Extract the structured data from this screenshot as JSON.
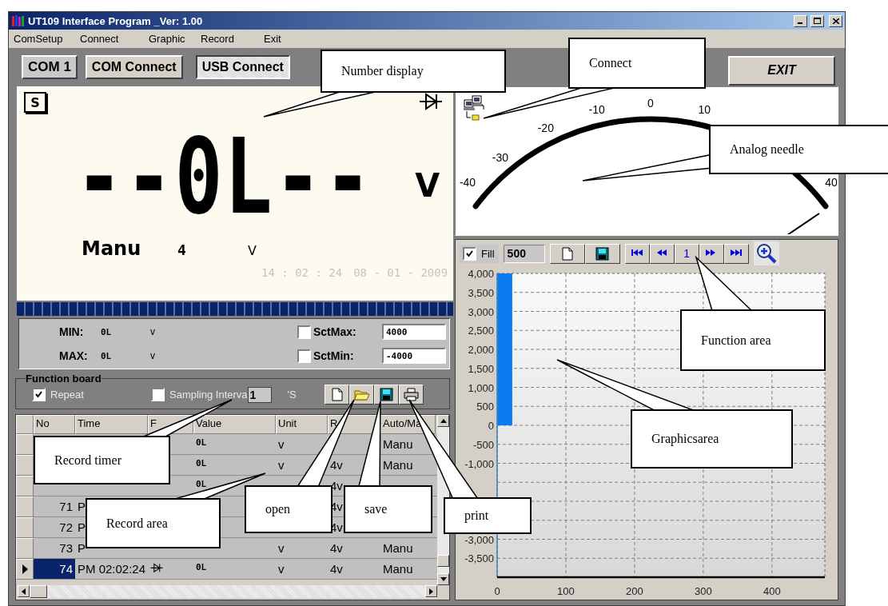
{
  "window": {
    "title": "UT109 Interface Program _Ver: 1.00"
  },
  "menu": [
    "ComSetup",
    "Connect",
    "Graphic",
    "Record",
    "Exit"
  ],
  "toolbar": {
    "port": "COM 1",
    "buttons": [
      {
        "label": "COM Connect",
        "selected": false
      },
      {
        "label": "USB Connect",
        "selected": true
      }
    ],
    "exit": "EXIT"
  },
  "display": {
    "mode": "S",
    "reading": "--0L--",
    "unit": "V",
    "range_mode": "Manu",
    "range": "4",
    "range_unit": "V",
    "time": "14 : 02 : 24",
    "date": "08 - 01 - 2009"
  },
  "bar_graph": {
    "level": 1
  },
  "min_max": {
    "min": {
      "label": "MIN:",
      "value": "0L",
      "unit": "v"
    },
    "max": {
      "label": "MAX:",
      "value": "0L",
      "unit": "v"
    },
    "set_max": {
      "label": "SctMax:",
      "checked": false,
      "value": "4000"
    },
    "set_min": {
      "label": "SctMin:",
      "checked": false,
      "value": "-4000"
    }
  },
  "function_board": {
    "title": "Function board",
    "repeat": {
      "label": "Repeat",
      "checked": true
    },
    "sampling": {
      "label": "Sampling Interva",
      "checked": false
    },
    "interval": "1",
    "interval_unit": "'S"
  },
  "records": {
    "columns": [
      "No",
      "Time",
      "F",
      "Value",
      "Unit",
      "R",
      "Auto/Ma"
    ],
    "rows": [
      {
        "value": "0L",
        "unit": "v",
        "mode": "Manu"
      },
      {
        "value": "0L",
        "unit": "v",
        "range": "4v",
        "mode": "Manu"
      },
      {
        "value": "0L",
        "range": "4v"
      },
      {
        "selected": false,
        "no": "71",
        "time": "P",
        "range": "4v"
      },
      {
        "selected": false,
        "no": "72",
        "time": "P",
        "range": "4v"
      },
      {
        "selected": false,
        "no": "73",
        "time": "P",
        "unit": "v",
        "range": "4v",
        "mode": "Manu"
      },
      {
        "selected": true,
        "no": "74",
        "time": "PM 02:02:24",
        "function_icon": true,
        "value": "0L",
        "unit": "v",
        "range": "4v",
        "mode": "Manu"
      }
    ]
  },
  "gauge": {
    "labels": [
      "-40",
      "-30",
      "-20",
      "-10",
      "0",
      "10",
      "40"
    ]
  },
  "chart_toolbar": {
    "fill": {
      "label": "Fill",
      "checked": true
    },
    "points": "500",
    "page": "1"
  },
  "chart": {
    "chart_data": {
      "type": "area",
      "grid": true,
      "x": [
        0,
        22
      ],
      "series": [
        {
          "color": "#0a7cf0",
          "values": [
            4000,
            4000
          ]
        }
      ],
      "xlim": [
        0,
        477
      ],
      "ylim": [
        -4000,
        4000
      ],
      "xticks": [
        0,
        100,
        200,
        300,
        400
      ],
      "yticks": [
        {
          "value": 4000,
          "label": "4,000"
        },
        {
          "value": 3500,
          "label": "3,500"
        },
        {
          "value": 3000,
          "label": "3,000"
        },
        {
          "value": 2500,
          "label": "2,500"
        },
        {
          "value": 2000,
          "label": "2,000"
        },
        {
          "value": 1500,
          "label": "1,500"
        },
        {
          "value": 1000,
          "label": "1,000"
        },
        500,
        0,
        -500,
        {
          "value": -1000,
          "label": "-1,000"
        },
        {
          "value": -3000,
          "label": "-3,000"
        },
        {
          "value": -3500,
          "label": "-3,500"
        }
      ]
    }
  },
  "callouts": [
    "Number display",
    "Connect",
    "Analog needle",
    "Function area",
    "Graphicsarea",
    "Record timer",
    "Record area",
    "open",
    "save",
    "print"
  ]
}
